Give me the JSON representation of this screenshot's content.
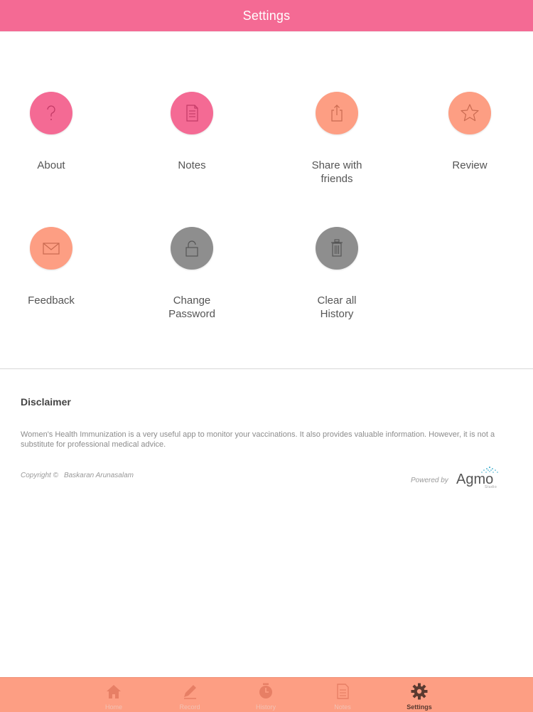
{
  "header": {
    "title": "Settings"
  },
  "colors": {
    "pink": "#f46a94",
    "orange": "#fd9e83",
    "gray": "#8e8e8e",
    "tabbar": "#fd9e83"
  },
  "tiles": [
    {
      "label": "About",
      "icon": "question-icon"
    },
    {
      "label": "Notes",
      "icon": "document-icon"
    },
    {
      "label": "Share with\nfriends",
      "icon": "share-icon"
    },
    {
      "label": "Review",
      "icon": "star-icon"
    },
    {
      "label": "Feedback",
      "icon": "mail-icon"
    },
    {
      "label": "Change\nPassword",
      "icon": "lock-icon"
    },
    {
      "label": "Clear all\nHistory",
      "icon": "trash-icon"
    }
  ],
  "disclaimer": {
    "title": "Disclaimer",
    "text": "Women's Health Immunization is a very useful app to monitor your vaccinations. It also provides valuable information. However, it is not a substitute for professional medical advice."
  },
  "footer": {
    "copyright_label": "Copyright ©",
    "copyright_owner": "Baskaran Arunasalam",
    "powered_by": "Powered by",
    "logo_text": "Agmo",
    "logo_sub": "Studio"
  },
  "tabs": [
    {
      "label": "Home",
      "icon": "home-icon",
      "active": false
    },
    {
      "label": "Record",
      "icon": "pencil-icon",
      "active": false
    },
    {
      "label": "History",
      "icon": "clock-icon",
      "active": false
    },
    {
      "label": "Notes",
      "icon": "notes-icon",
      "active": false
    },
    {
      "label": "Settings",
      "icon": "gear-icon",
      "active": true
    }
  ]
}
